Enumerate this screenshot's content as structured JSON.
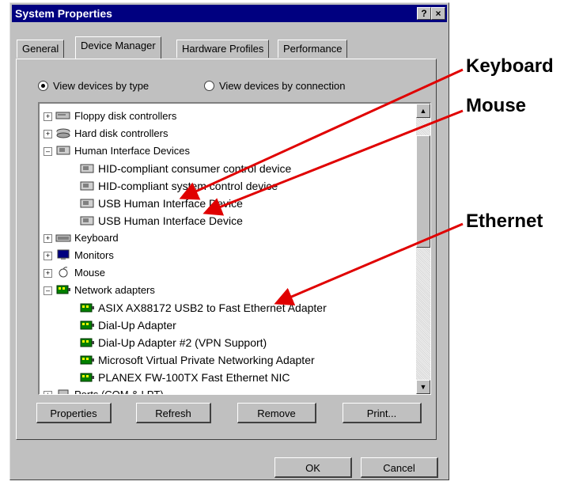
{
  "window": {
    "title": "System Properties",
    "help_btn": "?",
    "close_btn": "×"
  },
  "tabs": [
    "General",
    "Device Manager",
    "Hardware Profiles",
    "Performance"
  ],
  "radios": {
    "by_type": "View devices by type",
    "by_connection": "View devices by connection",
    "selected": "by_type"
  },
  "tree": [
    {
      "label": "Floppy disk controllers",
      "level": 0,
      "pm": "+",
      "icon": "floppy-controller-icon"
    },
    {
      "label": "Hard disk controllers",
      "level": 0,
      "pm": "+",
      "icon": "disk-controller-icon"
    },
    {
      "label": "Human Interface Devices",
      "level": 0,
      "pm": "-",
      "icon": "hid-icon"
    },
    {
      "label": "HID-compliant consumer control device",
      "level": 1,
      "pm": "",
      "icon": "hid-icon"
    },
    {
      "label": "HID-compliant system control device",
      "level": 1,
      "pm": "",
      "icon": "hid-icon"
    },
    {
      "label": "USB Human Interface Device",
      "level": 1,
      "pm": "",
      "icon": "hid-icon"
    },
    {
      "label": "USB Human Interface Device",
      "level": 1,
      "pm": "",
      "icon": "hid-icon"
    },
    {
      "label": "Keyboard",
      "level": 0,
      "pm": "+",
      "icon": "keyboard-icon"
    },
    {
      "label": "Monitors",
      "level": 0,
      "pm": "+",
      "icon": "monitor-icon"
    },
    {
      "label": "Mouse",
      "level": 0,
      "pm": "+",
      "icon": "mouse-icon"
    },
    {
      "label": "Network adapters",
      "level": 0,
      "pm": "-",
      "icon": "network-adapter-icon"
    },
    {
      "label": "ASIX AX88172 USB2 to Fast Ethernet Adapter",
      "level": 1,
      "pm": "",
      "icon": "network-adapter-icon"
    },
    {
      "label": "Dial-Up Adapter",
      "level": 1,
      "pm": "",
      "icon": "network-adapter-icon"
    },
    {
      "label": "Dial-Up Adapter #2 (VPN Support)",
      "level": 1,
      "pm": "",
      "icon": "network-adapter-icon"
    },
    {
      "label": "Microsoft Virtual Private Networking Adapter",
      "level": 1,
      "pm": "",
      "icon": "network-adapter-icon"
    },
    {
      "label": "PLANEX FW-100TX Fast Ethernet NIC",
      "level": 1,
      "pm": "",
      "icon": "network-adapter-icon"
    },
    {
      "label": "Ports (COM & LPT)",
      "level": 0,
      "pm": "+",
      "icon": "port-icon"
    }
  ],
  "buttons": {
    "properties": "Properties",
    "refresh": "Refresh",
    "remove": "Remove",
    "print": "Print...",
    "ok": "OK",
    "cancel": "Cancel"
  },
  "callouts": {
    "keyboard": "Keyboard",
    "mouse": "Mouse",
    "ethernet": "Ethernet"
  },
  "colors": {
    "titlebar": "#000080",
    "face": "#c0c0c0",
    "arrow": "#e00000",
    "hid_icon": "#808080",
    "net_icon": "#008000"
  }
}
